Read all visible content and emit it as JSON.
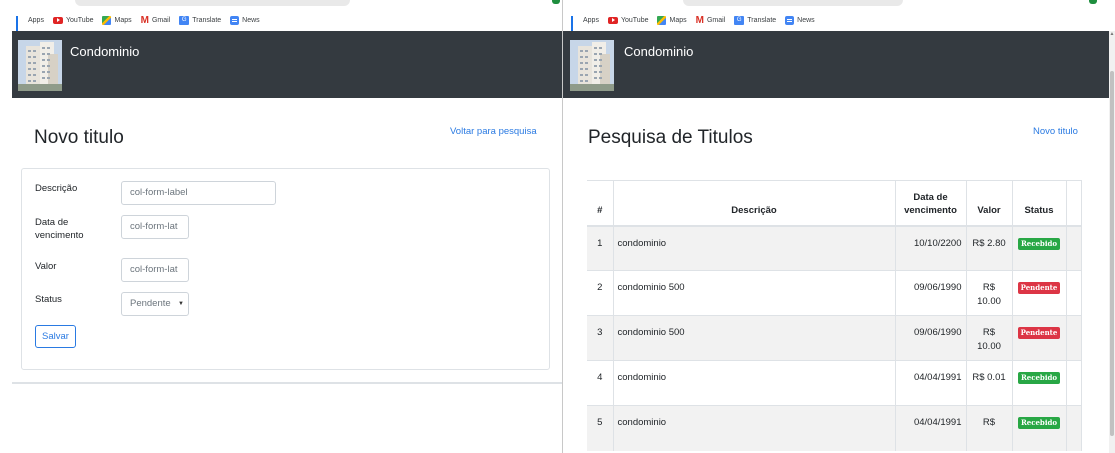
{
  "bookmarks": [
    "Apps",
    "YouTube",
    "Maps",
    "Gmail",
    "Translate",
    "News"
  ],
  "navbar": {
    "brand": "Condominio"
  },
  "left": {
    "title": "Novo titulo",
    "back_link": "Voltar para pesquisa",
    "form": {
      "descricao_label": "Descrição",
      "descricao_value": "col-form-label",
      "vencimento_label": "Data de vencimento",
      "vencimento_value": "col-form-lat",
      "valor_label": "Valor",
      "valor_value": "col-form-lat",
      "status_label": "Status",
      "status_value": "Pendente",
      "save_label": "Salvar"
    }
  },
  "right": {
    "title": "Pesquisa de Titulos",
    "new_link": "Novo titulo",
    "table": {
      "headers": [
        "#",
        "Descrição",
        "Data de vencimento",
        "Valor",
        "Status"
      ],
      "rows": [
        {
          "num": "1",
          "descricao": "condominio",
          "data": "10/10/2200",
          "valor": "R$ 2.80",
          "status": "Recebido"
        },
        {
          "num": "2",
          "descricao": "condominio 500",
          "data": "09/06/1990",
          "valor": "R$ 10.00",
          "status": "Pendente"
        },
        {
          "num": "3",
          "descricao": "condominio 500",
          "data": "09/06/1990",
          "valor": "R$ 10.00",
          "status": "Pendente"
        },
        {
          "num": "4",
          "descricao": "condominio",
          "data": "04/04/1991",
          "valor": "R$ 0.01",
          "status": "Recebido"
        },
        {
          "num": "5",
          "descricao": "condominio",
          "data": "04/04/1991",
          "valor": "R$",
          "status": "Recebido"
        }
      ]
    }
  },
  "colors": {
    "navbar": "#343a40",
    "link": "#2a7ae2",
    "recebido": "#28a745",
    "pendente": "#dc3545"
  }
}
